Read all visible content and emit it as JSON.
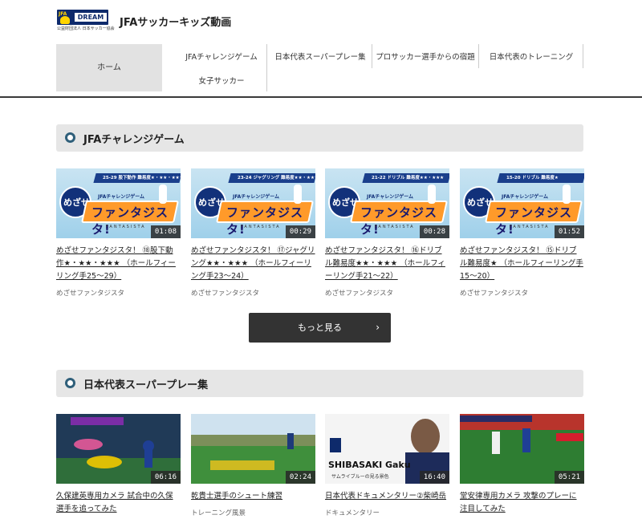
{
  "site": {
    "logo_jfa": "JFA",
    "logo_dream": "DREAM",
    "logo_sub": "公益財団法人 日本サッカー協会",
    "title": "JFAサッカーキッズ動画"
  },
  "nav": {
    "home": "ホーム",
    "challenge": "JFAチャレンジゲーム",
    "women": "女子サッカー",
    "superplay": "日本代表スーパープレー集",
    "prolessons": "プロサッカー選手からの宿題",
    "training": "日本代表のトレーニング"
  },
  "sections": {
    "challenge": {
      "title": "JFAチャレンジゲーム",
      "cards": [
        {
          "title": "めざせファンタジスタ！ ⑱股下動作★・★★・★★★ （ホールフィーリング手25〜29）",
          "category": "めざせファンタジスタ",
          "duration": "01:08",
          "topbar": "25-29 股下動作 難易度★・★★・★★★",
          "bubble": "めざせ",
          "sub": "JFAチャレンジゲーム",
          "big": "ファンタジスタ!",
          "eng": "FANTASISTA"
        },
        {
          "title": "めざせファンタジスタ！ ⑰ジャグリング★★・★★★ （ホールフィーリング手23〜24）",
          "category": "めざせファンタジスタ",
          "duration": "00:29",
          "topbar": "23-24 ジャグリング 難易度★★・★★★",
          "bubble": "めざせ",
          "sub": "JFAチャレンジゲーム",
          "big": "ファンタジスタ!",
          "eng": "FANTASISTA"
        },
        {
          "title": "めざせファンタジスタ！ ⑯ドリブル難易度★★・★★★ （ホールフィーリング手21〜22）",
          "category": "めざせファンタジスタ",
          "duration": "00:28",
          "topbar": "21-22 ドリブル 難易度★★・★★★",
          "bubble": "めざせ",
          "sub": "JFAチャレンジゲーム",
          "big": "ファンタジスタ!",
          "eng": "FANTASISTA"
        },
        {
          "title": "めざせファンタジスタ！ ⑮ドリブル難易度★ （ホールフィーリング手15〜20）",
          "category": "めざせファンタジスタ",
          "duration": "01:52",
          "topbar": "15-20 ドリブル 難易度★",
          "bubble": "めざせ",
          "sub": "JFAチャレンジゲーム",
          "big": "ファンタジスタ!",
          "eng": "FANTASISTA"
        }
      ],
      "more": "もっと見る",
      "more_chevron": "›"
    },
    "superplay": {
      "title": "日本代表スーパープレー集",
      "cards": [
        {
          "title": "久保建英専用カメラ 試合中の久保選手を追ってみた",
          "category": "",
          "duration": "06:16"
        },
        {
          "title": "乾貴士選手のシュート練習",
          "category": "トレーニング風景",
          "duration": "02:24"
        },
        {
          "title": "日本代表ドキュメンタリー②柴崎岳",
          "category": "ドキュメンタリー",
          "duration": "16:40",
          "overlay": "SHIBASAKI Gaku",
          "overlay_sub": "サムライブルーの見る景色"
        },
        {
          "title": "堂安律専用カメラ 攻撃のプレーに注目してみた",
          "category": "",
          "duration": "05:21"
        }
      ]
    }
  },
  "colors": {
    "accent": "#2f5f7a",
    "header_rule": "#3a3a3a",
    "more_button": "#333333"
  }
}
